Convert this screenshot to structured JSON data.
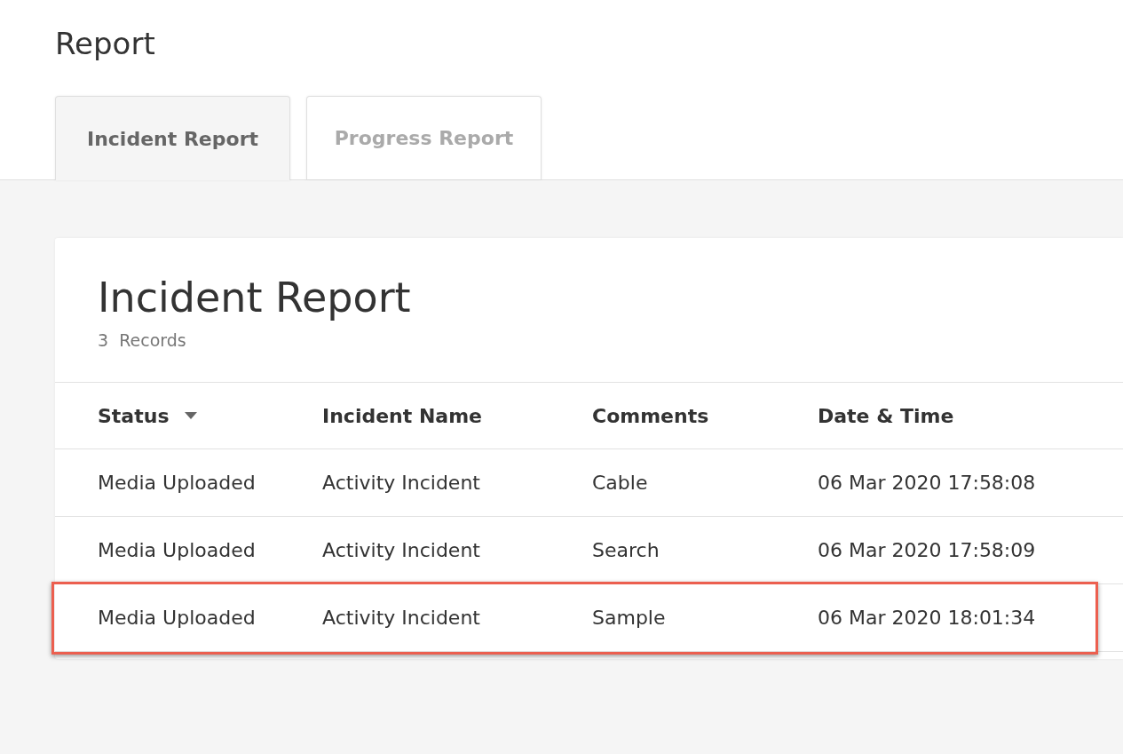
{
  "page_title": "Report",
  "tabs": [
    {
      "label": "Incident Report",
      "selected": true
    },
    {
      "label": "Progress Report",
      "selected": false
    }
  ],
  "card": {
    "title": "Incident Report",
    "record_count": "3  Records"
  },
  "table": {
    "columns": [
      {
        "label": "Status",
        "sorted": true
      },
      {
        "label": "Incident Name",
        "sorted": false
      },
      {
        "label": "Comments",
        "sorted": false
      },
      {
        "label": "Date & Time",
        "sorted": false
      }
    ],
    "rows": [
      {
        "cells": [
          "Media Uploaded",
          "Activity Incident",
          "Cable",
          "06 Mar 2020 17:58:08"
        ],
        "highlighted": false
      },
      {
        "cells": [
          "Media Uploaded",
          "Activity Incident",
          "Search",
          "06 Mar 2020 17:58:09"
        ],
        "highlighted": false
      },
      {
        "cells": [
          "Media Uploaded",
          "Activity Incident",
          "Sample",
          "06 Mar 2020 18:01:34"
        ],
        "highlighted": true
      }
    ]
  }
}
